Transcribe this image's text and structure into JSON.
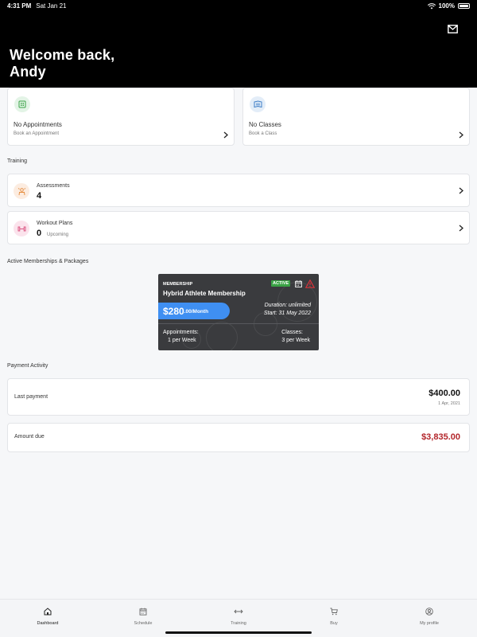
{
  "status_bar": {
    "time": "4:31 PM",
    "date": "Sat Jan 21",
    "battery": "100%"
  },
  "header": {
    "welcome_line1": "Welcome back,",
    "welcome_line2": "Andy"
  },
  "cards": {
    "appointments": {
      "title": "No Appointments",
      "subtitle": "Book an Appointment"
    },
    "classes": {
      "title": "No Classes",
      "subtitle": "Book a Class"
    }
  },
  "training": {
    "label": "Training",
    "assessments": {
      "title": "Assessments",
      "value": "4"
    },
    "workout_plans": {
      "title": "Workout Plans",
      "value": "0",
      "subtitle": "Upcoming"
    }
  },
  "memberships": {
    "label": "Active Memberships & Packages",
    "card": {
      "type": "MEMBERSHIP",
      "name": "Hybrid Athlete Membership",
      "status": "ACTIVE",
      "price": "$280",
      "price_suffix": ".00/Month",
      "duration": "Duration: unlimited",
      "start": "Start: 31 May 2022",
      "appointments_label": "Appointments:",
      "appointments_value": "1 per Week",
      "classes_label": "Classes:",
      "classes_value": "3 per Week"
    }
  },
  "payment": {
    "label": "Payment Activity",
    "last_payment": {
      "label": "Last payment",
      "amount": "$400.00",
      "date": "1 Apr, 2021"
    },
    "amount_due": {
      "label": "Amount due",
      "amount": "$3,835.00"
    }
  },
  "nav": {
    "dashboard": "Dashboard",
    "schedule": "Schedule",
    "training": "Training",
    "buy": "Buy",
    "profile": "My profile"
  },
  "colors": {
    "active_badge": "#3aa245",
    "price_pill": "#3f8ff2",
    "amount_due": "#b3262b",
    "header": "#000000"
  }
}
